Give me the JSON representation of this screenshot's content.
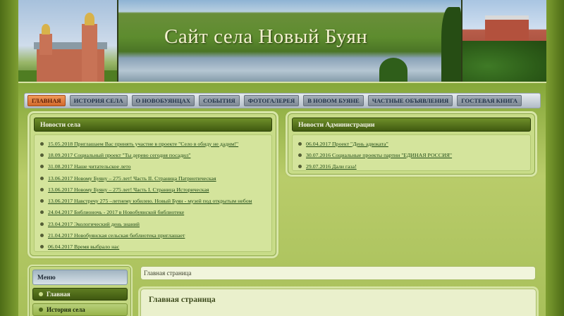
{
  "header": {
    "site_title": "Сайт села Новый Буян"
  },
  "nav": {
    "items": [
      {
        "label": "ГЛАВНАЯ",
        "active": true
      },
      {
        "label": "ИСТОРИЯ СЕЛА",
        "active": false
      },
      {
        "label": "О НОВОБУЯНЦАХ",
        "active": false
      },
      {
        "label": "СОБЫТИЯ",
        "active": false
      },
      {
        "label": "ФОТОГАЛЕРЕЯ",
        "active": false
      },
      {
        "label": "В НОВОМ БУЯНЕ",
        "active": false
      },
      {
        "label": "ЧАСТНЫЕ ОБЪЯВЛЕНИЯ",
        "active": false
      },
      {
        "label": "ГОСТЕВАЯ КНИГА",
        "active": false
      }
    ]
  },
  "village_news": {
    "title": "Новости села",
    "items": [
      "15.05.2018 Приглашаем Вас принять участие в проекте \"Село в обиду не дадим!\"",
      "18.09.2017 Социальный проект \"Ты дерево сегодня посадил\"",
      "31.08.2017 Наше читательское лето",
      "13.06.2017 Новому Буяну – 275 лет! Часть II. Страница Патриотическая",
      "13.06.2017 Новому Буяну – 275 лет! Часть I. Страница Историческая",
      "13.06.2017 Навстречу 275 –летнему юбилею. Новый Буян - музей под открытым небом",
      "24.04.2017 Библионочь - 2017 в Новобуянской библиотеке",
      "23.04.2017 Экологический день знаний",
      "21.04.2017 Новобуянская сельская библиотека приглашает",
      "06.04.2017 Время выбрало нас"
    ]
  },
  "admin_news": {
    "title": "Новости Администрации",
    "items": [
      "06.04.2017 Проект \"День адвоката\"",
      "30.07.2016 Социальные проекты партии \"ЕДИНАЯ РОССИЯ\"",
      "29.07.2016 Дали газа!"
    ]
  },
  "menu": {
    "title": "Меню",
    "items": [
      {
        "label": "Главная"
      },
      {
        "label": "История села"
      }
    ]
  },
  "breadcrumb": "Главная страница",
  "content": {
    "title": "Главная страница"
  }
}
